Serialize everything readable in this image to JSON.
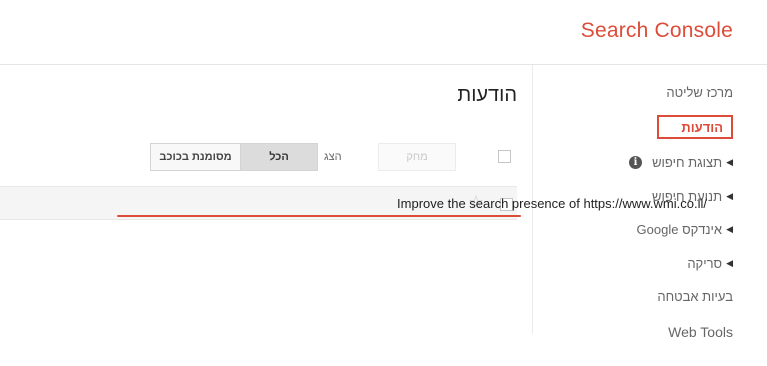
{
  "header": {
    "brand": "Search Console"
  },
  "sidebar": {
    "items": [
      {
        "label": "מרכז שליטה",
        "expandable": false
      },
      {
        "label": "הודעות",
        "expandable": false,
        "active": true
      },
      {
        "label": "תצוגת חיפוש",
        "expandable": true,
        "icon": "info-icon"
      },
      {
        "label": "תנועת חיפוש",
        "expandable": true
      },
      {
        "label": "אינדקס Google",
        "expandable": true
      },
      {
        "label": "סריקה",
        "expandable": true
      },
      {
        "label": "בעיות אבטחה",
        "expandable": false
      },
      {
        "label": "Web Tools",
        "expandable": false
      }
    ]
  },
  "main": {
    "title": "הודעות",
    "toolbar": {
      "delete_label": "מחק",
      "show_label": "הצג",
      "filter_all": "הכל",
      "filter_starred": "מסומנת בכוכב",
      "selected_filter": "הכל"
    },
    "messages": [
      {
        "text": "Improve the search presence of https://www.wmi.co.il/",
        "starred": false,
        "highlighted": true
      }
    ]
  },
  "colors": {
    "accent": "#dd4b39"
  }
}
